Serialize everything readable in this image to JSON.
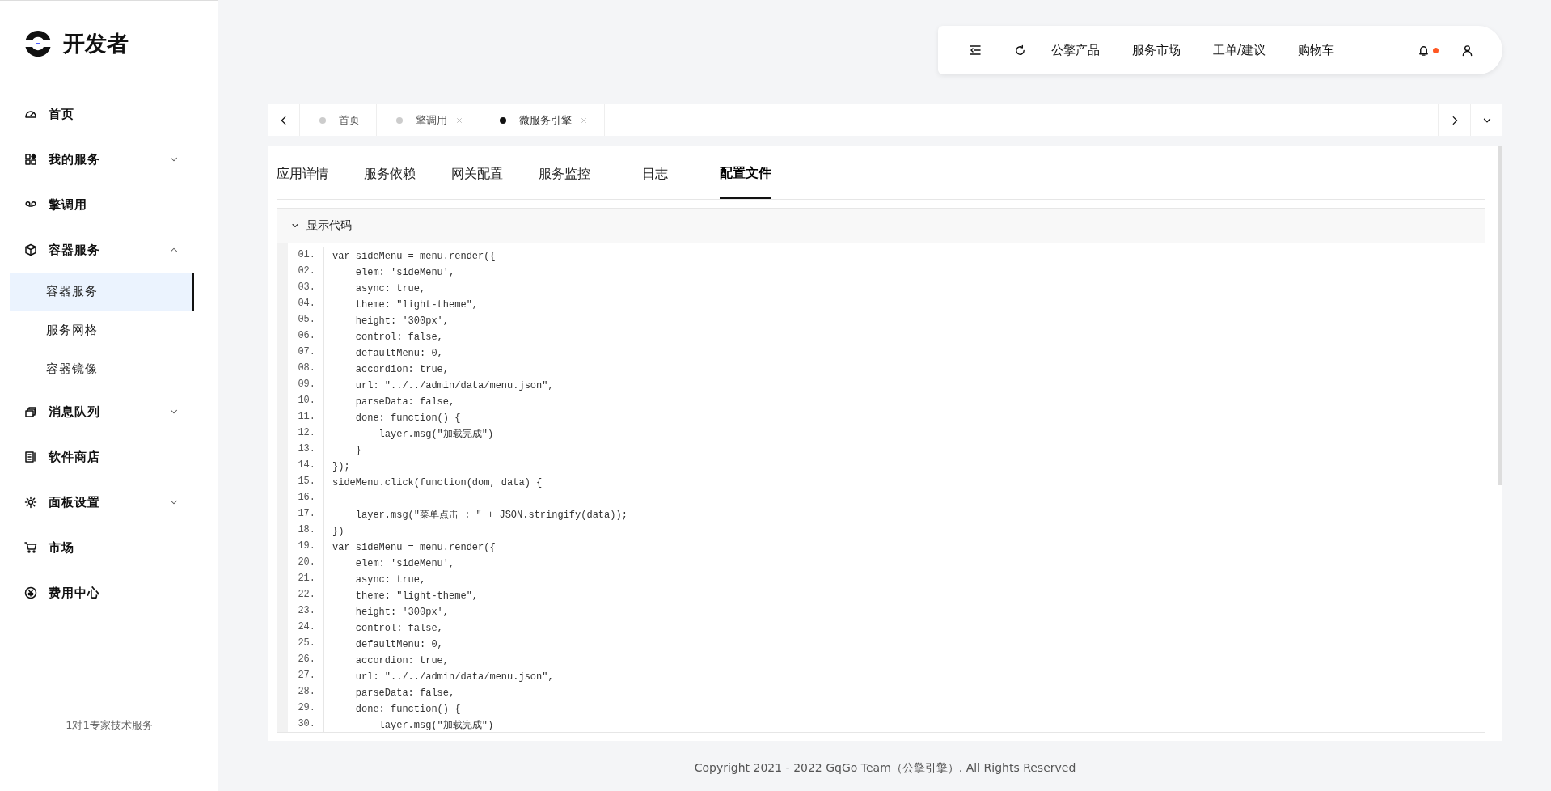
{
  "brand": {
    "title": "开发者"
  },
  "sidebar": {
    "items": [
      {
        "label": "首页"
      },
      {
        "label": "我的服务",
        "expanded": false
      },
      {
        "label": "擎调用"
      },
      {
        "label": "容器服务",
        "expanded": true,
        "children": [
          {
            "label": "容器服务",
            "selected": true
          },
          {
            "label": "服务网格",
            "selected": false
          },
          {
            "label": "容器镜像",
            "selected": false
          }
        ]
      },
      {
        "label": "消息队列",
        "expanded": false
      },
      {
        "label": "软件商店"
      },
      {
        "label": "面板设置",
        "expanded": false
      },
      {
        "label": "市场"
      },
      {
        "label": "费用中心"
      }
    ],
    "footer": "1对1专家技术服务"
  },
  "header": {
    "links": [
      "公擎产品",
      "服务市场",
      "工单/建议",
      "购物车"
    ],
    "notification": true
  },
  "page_tabs": [
    {
      "label": "首页",
      "selected": false,
      "closable": false
    },
    {
      "label": "擎调用",
      "selected": false,
      "closable": true
    },
    {
      "label": "微服务引擎",
      "selected": true,
      "closable": true
    }
  ],
  "content_tabs": [
    {
      "label": "应用详情",
      "selected": false
    },
    {
      "label": "服务依赖",
      "selected": false
    },
    {
      "label": "网关配置",
      "selected": false
    },
    {
      "label": "服务监控",
      "selected": false
    },
    {
      "label": "日志",
      "selected": false
    },
    {
      "label": "配置文件",
      "selected": true
    }
  ],
  "code_panel": {
    "title": "显示代码",
    "expanded": true,
    "lines": [
      {
        "num": "01.",
        "text": "var sideMenu = menu.render({"
      },
      {
        "num": "02.",
        "text": "    elem: 'sideMenu',"
      },
      {
        "num": "03.",
        "text": "    async: true,"
      },
      {
        "num": "04.",
        "text": "    theme: \"light-theme\","
      },
      {
        "num": "05.",
        "text": "    height: '300px',"
      },
      {
        "num": "06.",
        "text": "    control: false,"
      },
      {
        "num": "07.",
        "text": "    defaultMenu: 0,"
      },
      {
        "num": "08.",
        "text": "    accordion: true,"
      },
      {
        "num": "09.",
        "text": "    url: \"../../admin/data/menu.json\","
      },
      {
        "num": "10.",
        "text": "    parseData: false,"
      },
      {
        "num": "11.",
        "text": "    done: function() {"
      },
      {
        "num": "12.",
        "text": "        layer.msg(\"加载完成\")"
      },
      {
        "num": "13.",
        "text": "    }"
      },
      {
        "num": "14.",
        "text": "});"
      },
      {
        "num": "15.",
        "text": "sideMenu.click(function(dom, data) {"
      },
      {
        "num": "16."
      },
      {
        "num": "17.",
        "text": "    layer.msg(\"菜单点击 : \" + JSON.stringify(data));"
      },
      {
        "num": "18.",
        "text": "})"
      },
      {
        "num": "19.",
        "text": "var sideMenu = menu.render({"
      },
      {
        "num": "20.",
        "text": "    elem: 'sideMenu',"
      },
      {
        "num": "21.",
        "text": "    async: true,"
      },
      {
        "num": "22.",
        "text": "    theme: \"light-theme\","
      },
      {
        "num": "23.",
        "text": "    height: '300px',"
      },
      {
        "num": "24.",
        "text": "    control: false,"
      },
      {
        "num": "25.",
        "text": "    defaultMenu: 0,"
      },
      {
        "num": "26.",
        "text": "    accordion: true,"
      },
      {
        "num": "27.",
        "text": "    url: \"../../admin/data/menu.json\","
      },
      {
        "num": "28.",
        "text": "    parseData: false,"
      },
      {
        "num": "29.",
        "text": "    done: function() {"
      },
      {
        "num": "30.",
        "text": "        layer.msg(\"加载完成\")"
      }
    ]
  },
  "footer": "Copyright 2021 - 2022 GqGo Team（公擎引擎）. All Rights Reserved"
}
